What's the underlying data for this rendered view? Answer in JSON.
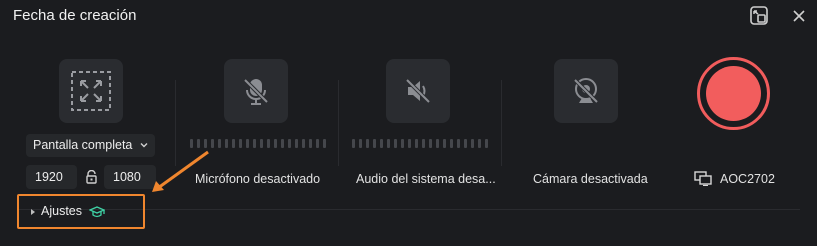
{
  "window": {
    "title": "Fecha de creación"
  },
  "sources": {
    "screen": {
      "mode": "Pantalla completa",
      "width": "1920",
      "height": "1080"
    },
    "microphone": {
      "label": "Micrófono desactivado"
    },
    "system_audio": {
      "label": "Audio del sistema desa..."
    },
    "camera": {
      "label": "Cámara desactivada"
    }
  },
  "monitor": {
    "name": "AOC2702"
  },
  "settings": {
    "label": "Ajustes"
  },
  "colors": {
    "record": "#f25d5d",
    "highlight": "#f0862e",
    "accent": "#3fd3a6"
  }
}
